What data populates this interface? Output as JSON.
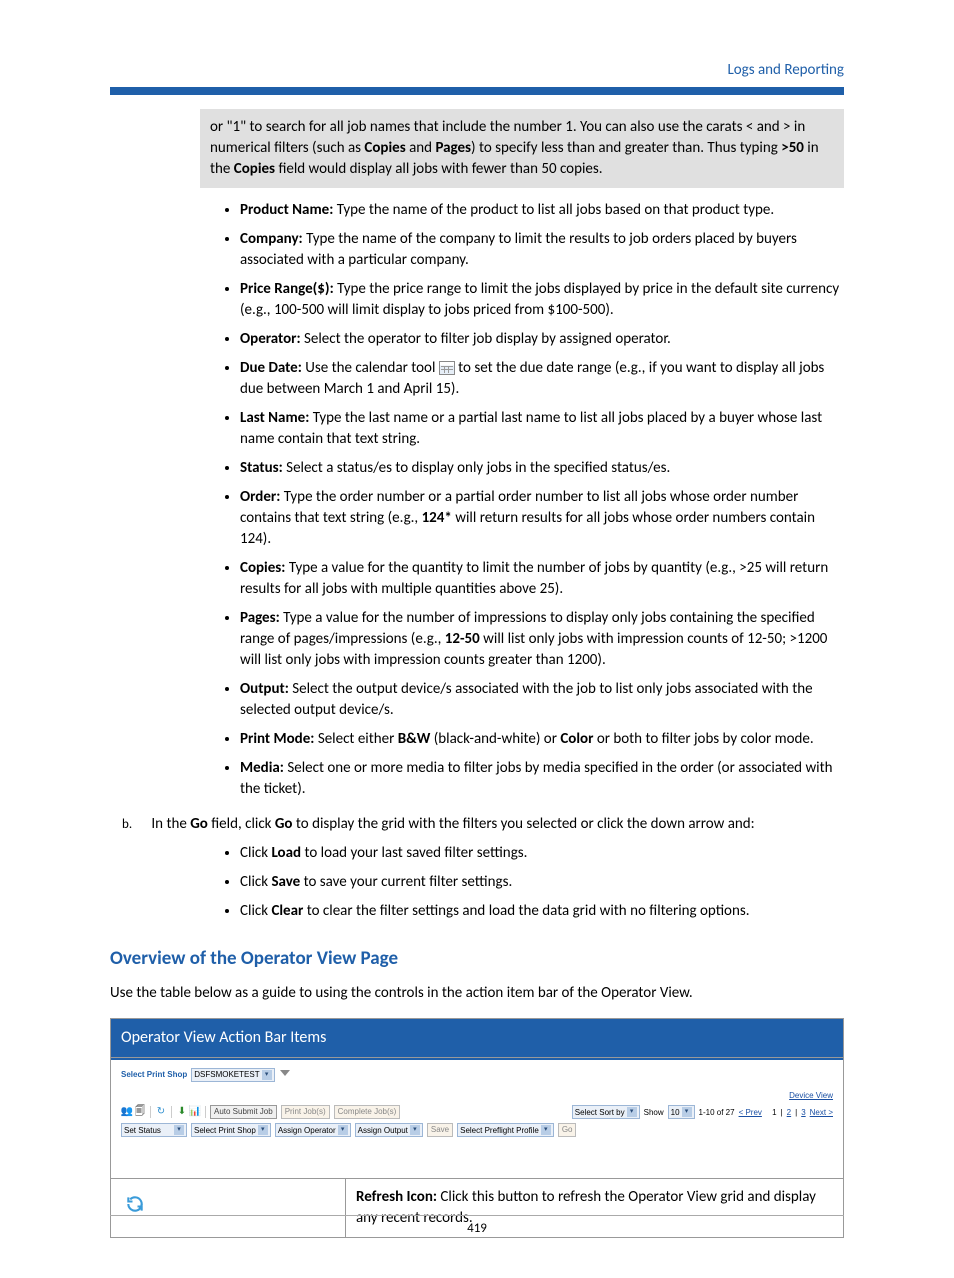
{
  "header": {
    "section_label": "Logs and Reporting"
  },
  "note": {
    "line1_a": "or \"1\" to search for all job names that include the number 1. You can also use the carats < and > in numerical filters (such as ",
    "copies_b": "Copies",
    "line1_b": " and ",
    "pages_b": "Pages",
    "line1_c": ") to specify less than and greater than. Thus typing ",
    "gt50_b": ">50",
    "line1_d": " in the ",
    "copies2_b": "Copies",
    "line1_e": " field would display all jobs with fewer than 50 copies."
  },
  "bullets": {
    "product_name_b": "Product Name:",
    "product_name_t": " Type the name of the product to list all jobs based on that product type.",
    "company_b": "Company:",
    "company_t": " Type the name of the company to limit the results to job orders placed by buyers associated with a particular company.",
    "price_b": "Price Range($):",
    "price_t": " Type the price range to limit the jobs displayed by price in the default site currency (e.g., 100-500 will limit display to jobs priced from $100-500).",
    "operator_b": "Operator:",
    "operator_t": " Select the operator to filter job display by assigned operator.",
    "due_b": "Due Date:",
    "due_t1": " Use the calendar tool ",
    "due_t2": " to set the due date range (e.g., if you want to display all jobs due between March 1 and April 15).",
    "lastname_b": "Last Name:",
    "lastname_t": " Type the last name or a partial last name to list all jobs placed by a buyer whose last name contain that text string.",
    "status_b": "Status:",
    "status_t": " Select a status/es to display only jobs in the specified status/es.",
    "order_b": "Order:",
    "order_t1": " Type the order number or a partial order number to list all jobs whose order number contains that text string (e.g., ",
    "order_ex_b": "124*",
    "order_t2": " will return results for all jobs whose order numbers contain 124).",
    "copies_b": "Copies:",
    "copies_t": " Type a value for the quantity to limit the number of jobs by quantity (e.g., >25 will return results for all jobs with multiple quantities above 25).",
    "pages_b": "Pages:",
    "pages_t1": " Type a value for the number of impressions to display only jobs containing the specified range of pages/impressions (e.g., ",
    "pages_ex_b": "12-50",
    "pages_t2": " will list only jobs with impression counts of 12-50; >1200 will list only jobs with impression counts greater than 1200).",
    "output_b": "Output:",
    "output_t": " Select the output device/s associated with the job to list only jobs associated with the selected output device/s.",
    "printmode_b": "Print Mode:",
    "printmode_t1": " Select either ",
    "printmode_bw_b": "B&W",
    "printmode_t2": " (black-and-white) or ",
    "printmode_color_b": "Color",
    "printmode_t3": " or both to filter jobs by color mode.",
    "media_b": "Media:",
    "media_t": " Select one or more media to filter jobs by media specified in the order (or associated with the ticket)."
  },
  "step_b": {
    "letter": "b.",
    "t1": "In the ",
    "go1_b": "Go",
    "t2": " field, click ",
    "go2_b": "Go",
    "t3": " to display the grid with the filters you selected or click the down arrow and:"
  },
  "inner": {
    "load_t1": "Click ",
    "load_b": "Load",
    "load_t2": " to load your last saved filter settings.",
    "save_t1": "Click ",
    "save_b": "Save",
    "save_t2": " to save your current filter settings.",
    "clear_t1": "Click ",
    "clear_b": "Clear",
    "clear_t2": " to clear the filter settings and load the data grid with no filtering options."
  },
  "section": {
    "heading": "Overview of the Operator View Page",
    "intro": "Use the table below as a guide to using the controls in the action item bar of the Operator View."
  },
  "table": {
    "header": "Operator View Action Bar Items",
    "refresh_b": "Refresh Icon:",
    "refresh_t": " Click this button to refresh the Operator View grid and display any recent records."
  },
  "ui": {
    "select_print_shop": "Select Print Shop",
    "shop_value": "DSFSMOKETEST",
    "device_view": "Device View",
    "auto_submit": "Auto Submit Job",
    "print_jobs": "Print Job(s)",
    "complete_jobs": "Complete Job(s)",
    "select_sort_by": "Select Sort by",
    "show": "Show",
    "show_value": "10",
    "pager_prefix": "1-10 of 27 ",
    "pager_prev": "< Prev",
    "pager_1": "1",
    "pager_2": "2",
    "pager_3": "3",
    "pager_next": "Next >",
    "set_status": "Set Status",
    "select_print_shop2": "Select Print Shop",
    "assign_operator": "Assign Operator",
    "assign_output": "Assign Output",
    "save": "Save",
    "select_preflight": "Select Preflight Profile",
    "go": "Go"
  },
  "footer": {
    "page_number": "419"
  }
}
